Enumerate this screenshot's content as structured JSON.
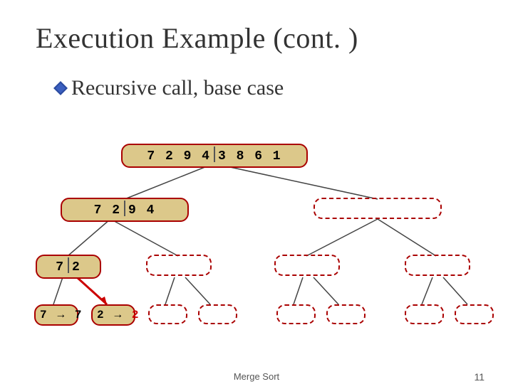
{
  "title": "Execution Example (cont. )",
  "subtitle": "Recursive call, base case",
  "footer": {
    "center": "Merge Sort",
    "page": "11"
  },
  "nodes": {
    "root": {
      "left": "7 2 9 4",
      "right": "3 8 6 1"
    },
    "l1a": {
      "left": "7 2",
      "right": "9 4"
    },
    "l2a": {
      "left": "7",
      "right": "2"
    },
    "leaf1": {
      "in": "7",
      "out": "7"
    },
    "leaf2": {
      "in": "2",
      "out": "2"
    }
  }
}
